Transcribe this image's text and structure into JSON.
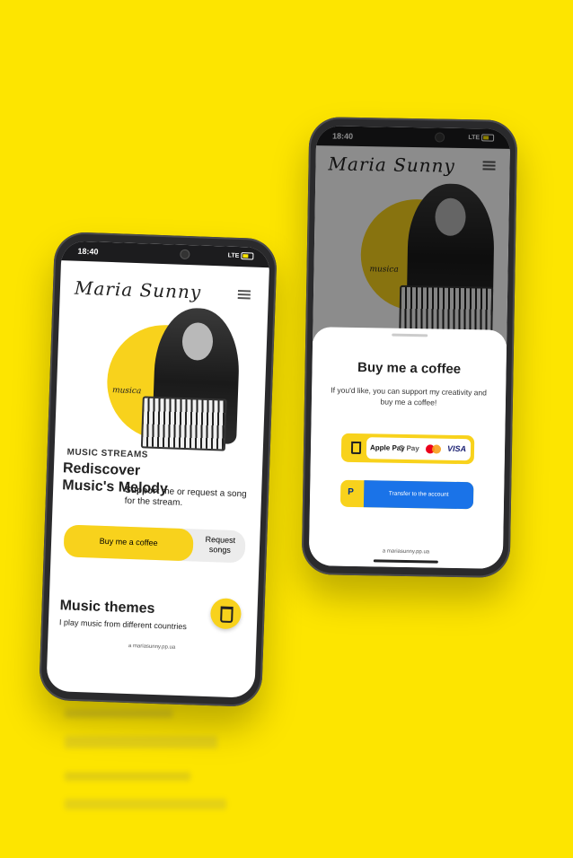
{
  "left_phone": {
    "status": {
      "time": "18:40",
      "network": "LTE"
    },
    "header": {
      "logo": "Maria Sunny"
    },
    "hero": {
      "badge": "musica"
    },
    "section_label": "MUSIC STREAMS",
    "title": "Rediscover Music's Melody",
    "support_bold": "Support",
    "support_rest": "me or request a song for the stream.",
    "buttons": {
      "primary": "Buy me a coffee",
      "secondary": "Request songs"
    },
    "themes_title": "Music themes",
    "themes_text": "I play music from different countries",
    "url": "a mariasunny.pp.ua"
  },
  "right_phone": {
    "status": {
      "time": "18:40",
      "network": "LTE"
    },
    "header": {
      "logo": "Maria Sunny"
    },
    "hero": {
      "badge": "musica"
    },
    "sheet": {
      "title": "Buy me a coffee",
      "text": "If you'd like, you can support my creativity and buy me a coffee!",
      "payment_methods": [
        "Apple Pay",
        "G Pay",
        "Mastercard",
        "VISA"
      ],
      "transfer_label": "Transfer to the account",
      "url": "a mariasunny.pp.ua"
    }
  },
  "colors": {
    "background": "#fde500",
    "accent_yellow": "#f8d21c",
    "transfer_blue": "#1a73e8"
  }
}
